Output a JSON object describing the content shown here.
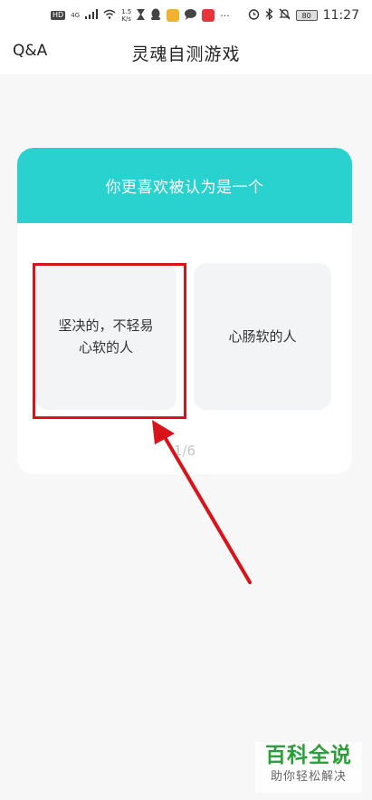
{
  "status_bar": {
    "network_badge": "HD",
    "signal_label": "4G",
    "speed_top": "1.5",
    "speed_bottom": "K/s",
    "more_glyph": "···",
    "battery": "80",
    "time": "11:27",
    "app_colors": [
      "#444444",
      "#f2b32a",
      "#444444",
      "#e8353b"
    ]
  },
  "header": {
    "left_label": "Q&A",
    "title": "灵魂自测游戏"
  },
  "question": {
    "prompt": "你更喜欢被认为是一个",
    "options": [
      {
        "line1": "坚决的，不轻易",
        "line2": "心软的人"
      },
      {
        "line1": "心肠软的人",
        "line2": ""
      }
    ],
    "progress": "1/6"
  },
  "colors": {
    "accent": "#29d1cf",
    "option_bg": "#f3f4f6",
    "annotation": "#d8141a",
    "watermark_green": "#2aa03a"
  },
  "watermark": {
    "main": "百科全说",
    "sub": "助你轻松解决"
  }
}
